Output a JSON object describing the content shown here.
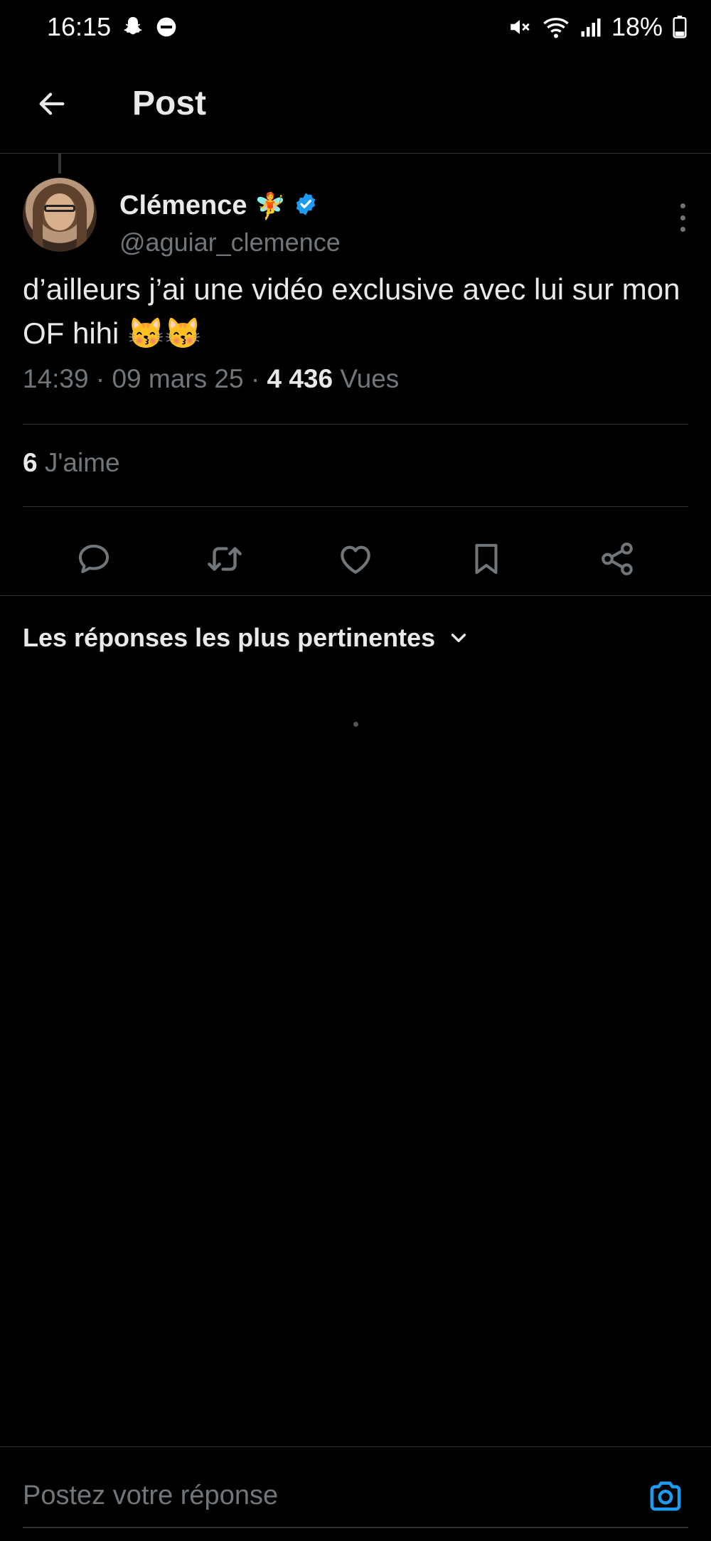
{
  "status_bar": {
    "time": "16:15",
    "battery": "18%",
    "icons": [
      "snapchat-icon",
      "dnd-icon",
      "mute-icon",
      "wifi-icon",
      "signal-icon",
      "battery-icon"
    ]
  },
  "header": {
    "title": "Post"
  },
  "post": {
    "author": {
      "name": "Clémence",
      "emoji": "🧚",
      "handle": "@aguiar_clemence",
      "verified": true
    },
    "text": "d’ailleurs j’ai une vidéo exclusive avec lui sur mon OF hihi 😽😽",
    "time": "14:39",
    "date": "09 mars 25",
    "views_count": "4 436",
    "views_label": "Vues",
    "likes_count": "6",
    "likes_label": "J'aime"
  },
  "actions": [
    "reply-icon",
    "retweet-icon",
    "like-icon",
    "bookmark-icon",
    "share-icon"
  ],
  "replies": {
    "sort_label": "Les réponses les plus pertinentes"
  },
  "composer": {
    "placeholder": "Postez votre réponse"
  },
  "colors": {
    "background": "#000000",
    "text": "#e7e9ea",
    "secondary": "#71767b",
    "divider": "#2f3336",
    "accent": "#1d9bf0"
  }
}
